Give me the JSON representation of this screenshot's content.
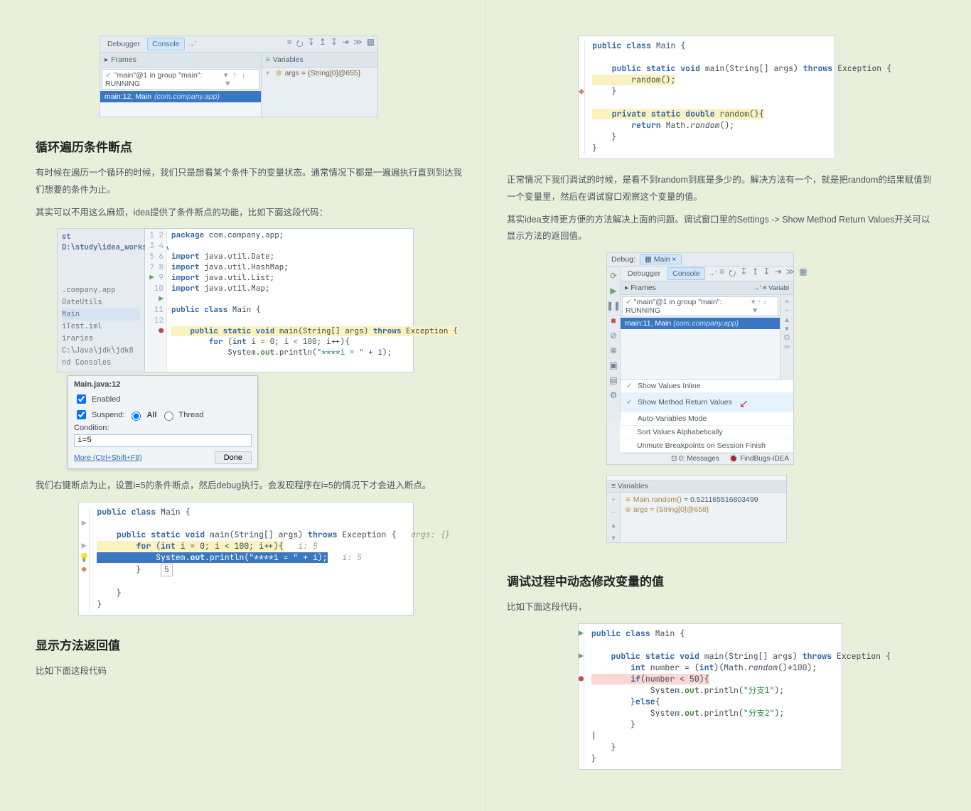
{
  "col1": {
    "img1": {
      "tabs": {
        "debugger": "Debugger",
        "console": "Console"
      },
      "frames_label": "Frames",
      "variables_label": "Variables",
      "thread": "\"main\"@1 in group \"main\": RUNNING",
      "frame_line": "main:12, Main",
      "frame_pkg": "(com.company.app)",
      "var_line": "args = {String[0]@655}"
    },
    "h1": "循环遍历条件断点",
    "p1": "有时候在遍历一个循环的时候，我们只是想看某个条件下的变量状态。通常情况下都是一遍遍执行直到到达我们想要的条件为止。",
    "p2": "其实可以不用这么麻烦，idea提供了条件断点的功能，比如下面这段代码：",
    "editor": {
      "path": "st D:\\study\\idea_workspace\\",
      "tree": [
        ".company.app",
        "DateUtils",
        "Main",
        "iTest.iml",
        "iraries",
        "C:\\Java\\jdk\\jdk8",
        "nd Consoles"
      ],
      "line_numbers": [
        "1",
        "2",
        "3",
        "4",
        "5",
        "6",
        "7",
        "8",
        "9",
        "10",
        "11",
        "12"
      ],
      "code": {
        "l1": "package com.company.app;",
        "l3": "import java.util.Date;",
        "l4": "import java.util.HashMap;",
        "l5": "import java.util.List;",
        "l6": "import java.util.Map;",
        "l8": "public class Main {",
        "l10": "    public static void main(String[] args) throws Exception {",
        "l11": "        for (int i = 0; i < 100; i++){",
        "l12": "            System.out.println(\"****i = \" + i);"
      }
    },
    "bp": {
      "title": "Main.java:12",
      "enabled": "Enabled",
      "suspend": "Suspend:",
      "all": "All",
      "thread": "Thread",
      "condition": "Condition:",
      "expr": "i=5",
      "more": "More (Ctrl+Shift+F8)",
      "done": "Done"
    },
    "p3": "我们右键断点为止，设置i=5的条件断点，然后debug执行。会发现程序在i=5的情况下才会进入断点。",
    "code2": {
      "l1": "public class Main {",
      "l3": "    public static void main(String[] args) throws Exception {",
      "l3v": "   args: {}",
      "l4": "        for (int i = 0; i < 100; i++){",
      "l4v": "   i: 5",
      "l5": "            System.out.println(\"****i = \" + i);",
      "l5v": "   i: 5",
      "l5t": "5",
      "l6": "        }",
      "l8": "    }",
      "l9": "}"
    },
    "h2": "显示方法返回值",
    "p4": "比如下面这段代码"
  },
  "col2": {
    "code1": {
      "l1": "public class Main {",
      "l3": "    public static void main(String[] args) throws Exception {",
      "l4": "        random();",
      "l5": "    }",
      "l7": "    private static double random(){",
      "l8": "        return Math.random();",
      "l9": "    }",
      "l10": "}"
    },
    "p1": "正常情况下我们调试的时候，是看不到random到底是多少的。解决方法有一个，就是把random的结果赋值到一个变量里，然后在调试窗口观察这个变量的值。",
    "p2": "其实idea支持更方便的方法解决上面的问题。调试窗口里的Settings -> Show Method Return Values开关可以显示方法的返回值。",
    "dw": {
      "debug": "Debug:",
      "main": "Main",
      "tabs": {
        "debugger": "Debugger",
        "console": "Console"
      },
      "frames": "Frames",
      "variabl": "Variabl",
      "thread": "\"main\"@1 in group \"main\": RUNNING",
      "frame": "main:11, Main",
      "frame_pkg": "(com.company.app)",
      "menu": {
        "m1": "Show Values Inline",
        "m2": "Show Method Return Values",
        "m3": "Auto-Variables Mode",
        "m4": "Sort Values Alphabetically",
        "m5": "Unmute Breakpoints on Session Finish"
      },
      "status": {
        "msg": "0: Messages",
        "fb": "FindBugs-IDEA"
      }
    },
    "vp": {
      "head": "Variables",
      "r1a": "Main.random()",
      "r1b": " = 0.521165516803499",
      "r2": "args = {String[0]@658}"
    },
    "h1": "调试过程中动态修改变量的值",
    "p3": "比如下面这段代码，",
    "code2": {
      "l1": "public class Main {",
      "l3": "    public static void main(String[] args) throws Exception {",
      "l4": "        int number = (int)(Math.random()*100);",
      "l5": "        if(number < 50){",
      "l6": "            System.out.println(\"分支1\");",
      "l7": "        }else{",
      "l8": "            System.out.println(\"分支2\");",
      "l9": "        }",
      "l10": "|",
      "l11": "    }",
      "l12": "}"
    }
  }
}
